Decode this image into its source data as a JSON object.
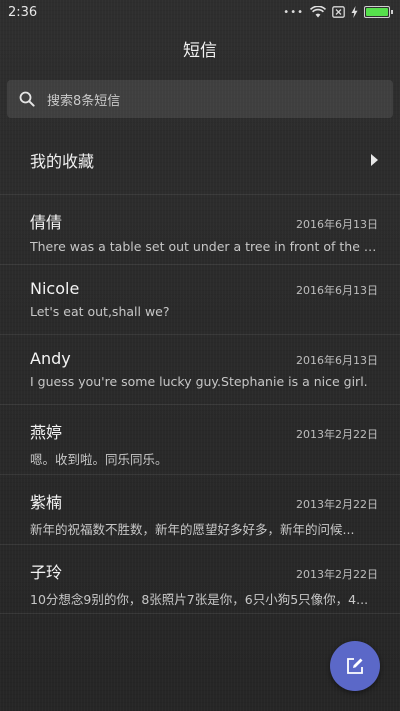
{
  "status_bar": {
    "time": "2:36",
    "icons": [
      "dots-icon",
      "wifi-icon",
      "no-sim-icon",
      "charging-icon",
      "battery-icon"
    ]
  },
  "title": "短信",
  "search": {
    "placeholder": "搜索8条短信",
    "icon": "search-icon"
  },
  "favorites": {
    "label": "我的收藏",
    "icon": "chevron-right-icon"
  },
  "messages": [
    {
      "name": "倩倩",
      "date": "2016年6月13日",
      "preview": "There was a table set out under a tree in front of the ho..."
    },
    {
      "name": "Nicole",
      "date": "2016年6月13日",
      "preview": "Let's eat out,shall we?"
    },
    {
      "name": "Andy",
      "date": "2016年6月13日",
      "preview": "I guess you're some lucky guy.Stephanie is a nice girl."
    },
    {
      "name": "燕婷",
      "date": "2013年2月22日",
      "preview": "嗯。收到啦。同乐同乐。"
    },
    {
      "name": "紫楠",
      "date": "2013年2月22日",
      "preview": "新年的祝福数不胜数，新年的愿望好多好多，新年的问候..."
    },
    {
      "name": "子玲",
      "date": "2013年2月22日",
      "preview": "10分想念9别的你，8张照片7张是你，6只小狗5只像你，4..."
    }
  ],
  "fab": {
    "icon": "compose-icon",
    "color": "#5b68c8"
  },
  "colors": {
    "battery": "#56e04c",
    "accent": "#5b68c8"
  }
}
